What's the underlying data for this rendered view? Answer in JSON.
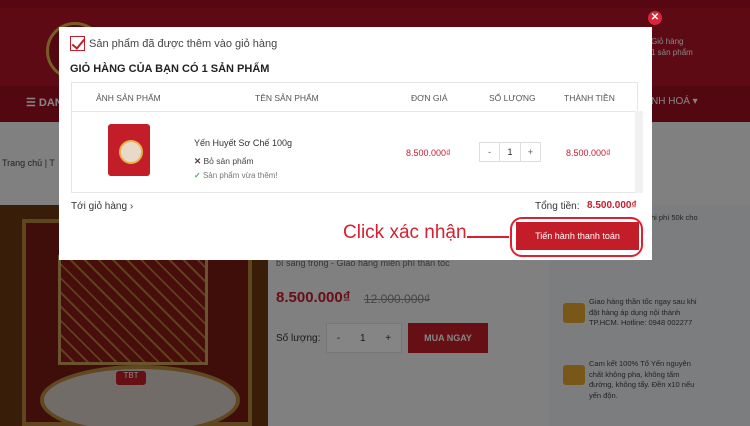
{
  "header": {
    "cart_label": "Giỏ hàng",
    "cart_count": "1 sản phẩm",
    "nav_menu_label": "DAN",
    "nav_right_label": "NH HOÁ ▾"
  },
  "breadcrumb": {
    "home": "Trang chủ",
    "sep": "|",
    "next": "T"
  },
  "product_page": {
    "subtext": "bì sang trọng - Giao hàng miễn phí thần tốc",
    "price": "8.500.000₫",
    "old_price": "12.000.000₫",
    "qty_label": "Số lượng:",
    "qty_minus": "-",
    "qty_value": "1",
    "qty_plus": "+",
    "buy_button": "MUA NGAY",
    "badge": "TBT",
    "side_items": [
      "ển với đơn /Linh Chi phí 50k cho n trên 2.000.000₫",
      "Giao hàng thần tốc ngay sau khi đặt hàng áp dụng nội thành TP.HCM. Hotline: 0948 002277",
      "Cam kết 100% Tổ Yến nguyên chất không pha, không tẩm đường, không tẩy. Đền x10 nếu yến độn."
    ]
  },
  "modal": {
    "close_icon": "close-icon",
    "added_notice": "Sản phẩm đã được thêm vào giỏ hàng",
    "cart_heading": "GIỎ HÀNG CỦA BẠN CÓ 1 SẢN PHẨM",
    "columns": [
      "ẢNH SẢN PHẨM",
      "TÊN SẢN PHẨM",
      "ĐƠN GIÁ",
      "SỐ LƯỢNG",
      "THÀNH TIỀN"
    ],
    "item": {
      "name": "Yến Huyết Sơ Chế 100g",
      "remove_label": "Bỏ sản phẩm",
      "added_label": "Sản phẩm vừa thêm!",
      "unit_price": "8.500.000₫",
      "qty_minus": "-",
      "qty": "1",
      "qty_plus": "+",
      "line_total": "8.500.000₫"
    },
    "goto_cart": "Tới giỏ hàng ›",
    "total_label": "Tổng tiền:",
    "total_value": "8.500.000₫",
    "checkout_button": "Tiến hành thanh toán"
  },
  "annotation": {
    "callout_text": "Click xác nhận",
    "accent_color": "#d6202f"
  }
}
